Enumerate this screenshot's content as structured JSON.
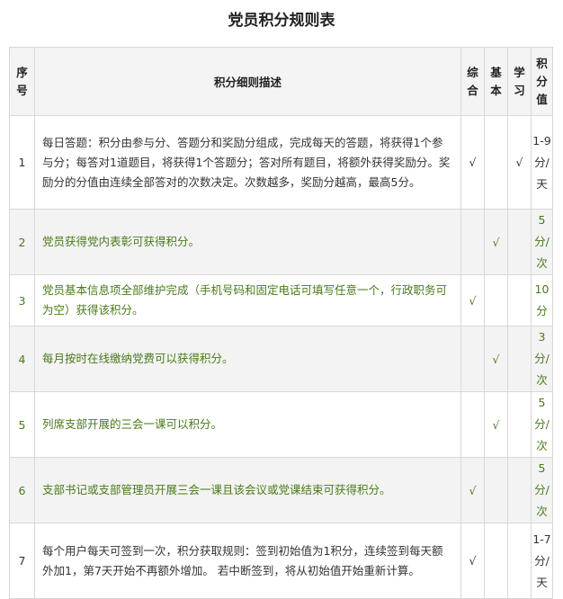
{
  "title": "党员积分规则表",
  "headers": {
    "no": "序号",
    "desc": "积分细则描述",
    "zonghe": "综合",
    "jiben": "基本",
    "xuexi": "学习",
    "points": "积分值"
  },
  "rows": [
    {
      "no": "1",
      "desc": "每日答题：积分由参与分、答题分和奖励分组成，完成每天的答题，将获得1个参与分；每答对1道题目，将获得1个答题分；答对所有题目，将额外获得奖励分。奖励分的分值由连续全部答对的次数决定。次数越多，奖励分越高，最高5分。",
      "zonghe": "√",
      "jiben": "",
      "xuexi": "√",
      "points": "1-9分/天"
    },
    {
      "no": "2",
      "desc": "党员获得党内表彰可获得积分。",
      "zonghe": "",
      "jiben": "√",
      "xuexi": "",
      "points": "5分/次"
    },
    {
      "no": "3",
      "desc": "党员基本信息项全部维护完成（手机号码和固定电话可填写任意一个，行政职务可为空）获得该积分。",
      "zonghe": "√",
      "jiben": "",
      "xuexi": "",
      "points": "10分"
    },
    {
      "no": "4",
      "desc": "每月按时在线缴纳党费可以获得积分。",
      "zonghe": "",
      "jiben": "√",
      "xuexi": "",
      "points": "3分/次"
    },
    {
      "no": "5",
      "desc": "列席支部开展的三会一课可以积分。",
      "zonghe": "",
      "jiben": "√",
      "xuexi": "",
      "points": "5分/次"
    },
    {
      "no": "6",
      "desc": "支部书记或支部管理员开展三会一课且该会议或党课结束可获得积分。",
      "zonghe": "√",
      "jiben": "",
      "xuexi": "",
      "points": "5分/次"
    },
    {
      "no": "7",
      "desc": "每个用户每天可签到一次，积分获取规则：签到初始值为1积分，连续签到每天额外加1，第7天开始不再额外增加。 若中断签到，将从初始值开始重新计算。",
      "zonghe": "√",
      "jiben": "",
      "xuexi": "",
      "points": "1-7分/天"
    }
  ],
  "colors": {
    "green_text": "#4a7a1a",
    "shaded_row": "#f3f3f3",
    "border": "#d8d8d8"
  }
}
